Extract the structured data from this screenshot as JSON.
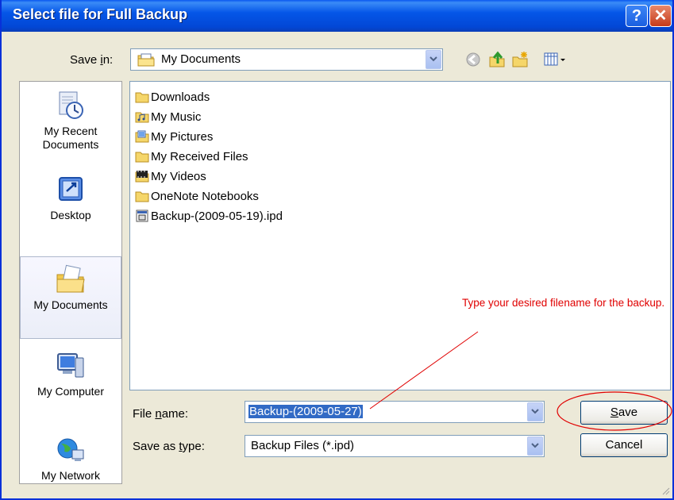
{
  "window": {
    "title": "Select file for Full Backup",
    "help_label": "?",
    "close_label": "✕"
  },
  "toolbar": {
    "save_in_label_pre": "Save ",
    "save_in_label_u": "i",
    "save_in_label_post": "n:",
    "save_in_value": "My Documents"
  },
  "places": {
    "recent_line1": "My Recent",
    "recent_line2": "Documents",
    "desktop": "Desktop",
    "my_documents": "My Documents",
    "my_computer": "My Computer",
    "my_network": "My Network"
  },
  "files": [
    {
      "name": "Downloads",
      "icon": "folder-icon"
    },
    {
      "name": "My Music",
      "icon": "music-folder-icon"
    },
    {
      "name": "My Pictures",
      "icon": "pictures-folder-icon"
    },
    {
      "name": "My Received Files",
      "icon": "folder-icon"
    },
    {
      "name": "My Videos",
      "icon": "videos-folder-icon"
    },
    {
      "name": "OneNote Notebooks",
      "icon": "folder-icon"
    },
    {
      "name": "Backup-(2009-05-19).ipd",
      "icon": "backup-file-icon"
    }
  ],
  "form": {
    "filename_label_pre": "File ",
    "filename_label_u": "n",
    "filename_label_post": "ame:",
    "filename_value": "Backup-(2009-05-27)",
    "type_label_pre": "Save as ",
    "type_label_u": "t",
    "type_label_post": "ype:",
    "type_value": "Backup Files (*.ipd)"
  },
  "buttons": {
    "save_u": "S",
    "save_rest": "ave",
    "cancel": "Cancel"
  },
  "annotation": {
    "text": "Type your desired filename for the backup.",
    "color": "#e00000"
  }
}
